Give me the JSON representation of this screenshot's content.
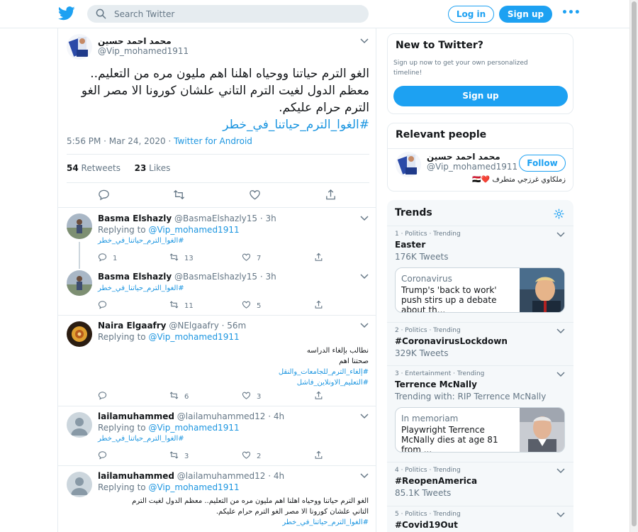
{
  "header": {
    "search_placeholder": "Search Twitter",
    "login_label": "Log in",
    "signup_label": "Sign up",
    "more_label": "•••"
  },
  "colors": {
    "accent": "#1da1f2",
    "link": "#1b95e0",
    "muted": "#657786",
    "border": "#e6ecf0"
  },
  "main_tweet": {
    "name": "محمد احمد حسين",
    "handle": "@Vip_mohamed1911",
    "text_line1": "الغو الترم حياتنا ووحياه اهلنا اهم مليون مره من التعليم..",
    "text_line2": "معظم الدول لغيت الترم التاني علشان كورونا الا مصر الغو",
    "text_line3": "الترم حرام عليكم.",
    "hashtag": "#الغوا_الترم_حياتنا_في_خطر",
    "time": "5:56 PM · Mar 24, 2020",
    "via": "Twitter for Android",
    "retweets": "54",
    "retweets_label": "Retweets",
    "likes": "23",
    "likes_label": "Likes"
  },
  "replies": [
    {
      "name": "Basma Elshazly",
      "handle": "@BasmaElshazly15 · 3h",
      "replying_label": "Replying to",
      "replying_to": "@Vip_mohamed1911",
      "hashtag": "#الغوا_الترم_حياتنا_في_خطر",
      "replies": "1",
      "retweets": "13",
      "likes": "7"
    },
    {
      "name": "Basma Elshazly",
      "handle": "@BasmaElshazly15 · 3h",
      "hashtag": "#الغوا_الترم_حياتنا_في_خطر",
      "replies": "",
      "retweets": "11",
      "likes": "5"
    },
    {
      "name": "Naira Elgaafry",
      "handle": "@NElgaafry · 56m",
      "replying_label": "Replying to",
      "replying_to": "@Vip_mohamed1911",
      "line1": "نطالب  بإلغاء الدراسه",
      "line2": "صحتنا اهم",
      "tag1": "#إلغاء_الترم_للجامعات_والنقل",
      "tag2": "#التعليم_الاونلاين_فاشل",
      "replies": "",
      "retweets": "6",
      "likes": "3"
    },
    {
      "name": "lailamuhammed",
      "handle": "@lailamuhammed12 · 4h",
      "replying_label": "Replying to",
      "replying_to": "@Vip_mohamed1911",
      "hashtag": "#الغوا_الترم_حياتنا_في_خطر",
      "replies": "",
      "retweets": "3",
      "likes": "2"
    },
    {
      "name": "lailamuhammed",
      "handle": "@lailamuhammed12 · 4h",
      "replying_label": "Replying to",
      "replying_to": "@Vip_mohamed1911",
      "line1": "الغو الترم حياتنا ووحياه اهلنا اهم مليون مره من التعليم.. معظم الدول لغيت الترم",
      "line2": "التاني علشان كورونا الا مصر الغو الترم حرام عليكم.",
      "hashtag": "#الغوا_الترم_حياتنا_في_خطر"
    }
  ],
  "new_to_twitter": {
    "title": "New to Twitter?",
    "subtitle": "Sign up now to get your own personalized timeline!",
    "button": "Sign up"
  },
  "relevant_people": {
    "title": "Relevant people",
    "name": "محمد احمد حسين",
    "handle": "@Vip_mohamed1911",
    "follow": "Follow",
    "bio": "زملكاوي غرزجي متطرف ❤️🇪🇬"
  },
  "trends": {
    "title": "Trends",
    "items": [
      {
        "meta": "1 · Politics · Trending",
        "title": "Easter",
        "count": "176K Tweets"
      },
      {
        "meta": "2 · Politics · Trending",
        "title": "#CoronavirusLockdown",
        "count": "329K Tweets"
      },
      {
        "meta": "3 · Entertainment · Trending",
        "title": "Terrence McNally",
        "count": "Trending with: RIP Terrence McNally"
      },
      {
        "meta": "4 · Politics · Trending",
        "title": "#ReopenAmerica",
        "count": "85.1K Tweets"
      },
      {
        "meta": "5 · Politics · Trending",
        "title": "#Covid19Out",
        "count": ""
      }
    ],
    "news": [
      {
        "category": "Coronavirus",
        "headline": "Trump's 'back to work' push stirs up a debate about th..."
      },
      {
        "category": "In memoriam",
        "headline": "Playwright Terrence McNally dies at age 81 from ..."
      }
    ]
  }
}
